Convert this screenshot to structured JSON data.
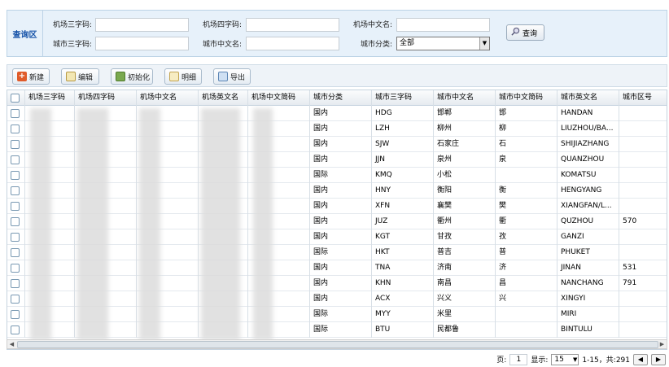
{
  "query": {
    "title": "查询区",
    "fields": {
      "airport_code3_label": "机场三字码:",
      "airport_code4_label": "机场四字码:",
      "airport_cn_name_label": "机场中文名:",
      "city_code3_label": "城市三字码:",
      "city_cn_name_label": "城市中文名:",
      "city_category_label": "城市分类:",
      "city_category_value": "全部"
    },
    "search_label": "查询"
  },
  "toolbar": {
    "new_label": "新建",
    "edit_label": "编辑",
    "init_label": "初始化",
    "detail_label": "明细",
    "export_label": "导出"
  },
  "colors": {
    "panel_bg": "#e7f1fa",
    "title_blue": "#1552a8"
  },
  "grid": {
    "columns": [
      "机场三字码",
      "机场四字码",
      "机场中文名",
      "机场英文名",
      "机场中文简码",
      "城市分类",
      "城市三字码",
      "城市中文名",
      "城市中文简码",
      "城市英文名",
      "城市区号"
    ],
    "rows": [
      [
        "",
        "",
        "",
        "",
        "",
        "国内",
        "HDG",
        "邯郸",
        "邯",
        "HANDAN",
        ""
      ],
      [
        "",
        "",
        "",
        "",
        "",
        "国内",
        "LZH",
        "柳州",
        "柳",
        "LIUZHOU/BA...",
        ""
      ],
      [
        "",
        "",
        "",
        "",
        "",
        "国内",
        "SJW",
        "石家庄",
        "石",
        "SHIJIAZHANG",
        ""
      ],
      [
        "",
        "",
        "",
        "",
        "",
        "国内",
        "JJN",
        "泉州",
        "泉",
        "QUANZHOU",
        ""
      ],
      [
        "",
        "",
        "",
        "",
        "",
        "国际",
        "KMQ",
        "小松",
        "",
        "KOMATSU",
        ""
      ],
      [
        "",
        "",
        "",
        "",
        "",
        "国内",
        "HNY",
        "衡阳",
        "衡",
        "HENGYANG",
        ""
      ],
      [
        "",
        "",
        "",
        "",
        "",
        "国内",
        "XFN",
        "襄樊",
        "樊",
        "XIANGFAN/L...",
        ""
      ],
      [
        "",
        "",
        "",
        "",
        "",
        "国内",
        "JUZ",
        "衢州",
        "衢",
        "QUZHOU",
        "570"
      ],
      [
        "",
        "",
        "",
        "",
        "",
        "国内",
        "KGT",
        "甘孜",
        "孜",
        "GANZI",
        ""
      ],
      [
        "",
        "",
        "",
        "",
        "",
        "国际",
        "HKT",
        "普吉",
        "普",
        "PHUKET",
        ""
      ],
      [
        "",
        "",
        "",
        "",
        "",
        "国内",
        "TNA",
        "济南",
        "济",
        "JINAN",
        "531"
      ],
      [
        "",
        "",
        "",
        "",
        "",
        "国内",
        "KHN",
        "南昌",
        "昌",
        "NANCHANG",
        "791"
      ],
      [
        "",
        "",
        "",
        "",
        "",
        "国内",
        "ACX",
        "兴义",
        "兴",
        "XINGYI",
        ""
      ],
      [
        "",
        "",
        "",
        "",
        "",
        "国际",
        "MYY",
        "米里",
        "",
        "MIRI",
        ""
      ],
      [
        "",
        "",
        "",
        "",
        "",
        "国际",
        "BTU",
        "民都鲁",
        "",
        "BINTULU",
        ""
      ]
    ]
  },
  "pager": {
    "page_label": "页:",
    "page_value": "1",
    "show_label": "显示:",
    "page_size": "15",
    "range_text": "1-15，共:291"
  }
}
